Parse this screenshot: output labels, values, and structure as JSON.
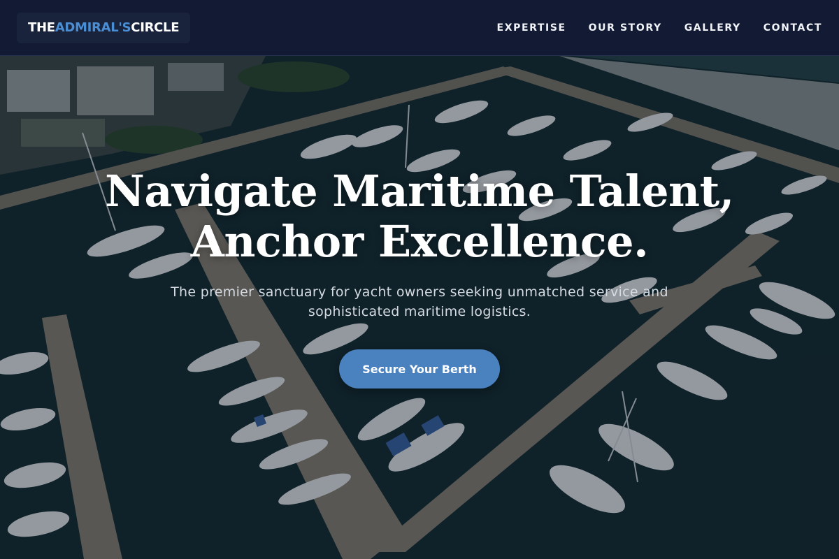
{
  "nav": {
    "logo": {
      "part1": "THE ",
      "part2": "ADMIRAL'S",
      "part3": " CIRCLE"
    },
    "links": [
      "EXPERTISE",
      "OUR STORY",
      "GALLERY",
      "CONTACT"
    ]
  },
  "hero": {
    "title_line1": "Navigate Maritime Talent,",
    "title_line2": "Anchor Excellence.",
    "subtitle": "The premier sanctuary for yacht owners seeking unmatched service and sophisticated maritime logistics.",
    "cta_label": "Secure Your Berth"
  },
  "colors": {
    "navbar": "#121b33",
    "accent": "#4a8fd6",
    "cta": "#4a81bf"
  }
}
